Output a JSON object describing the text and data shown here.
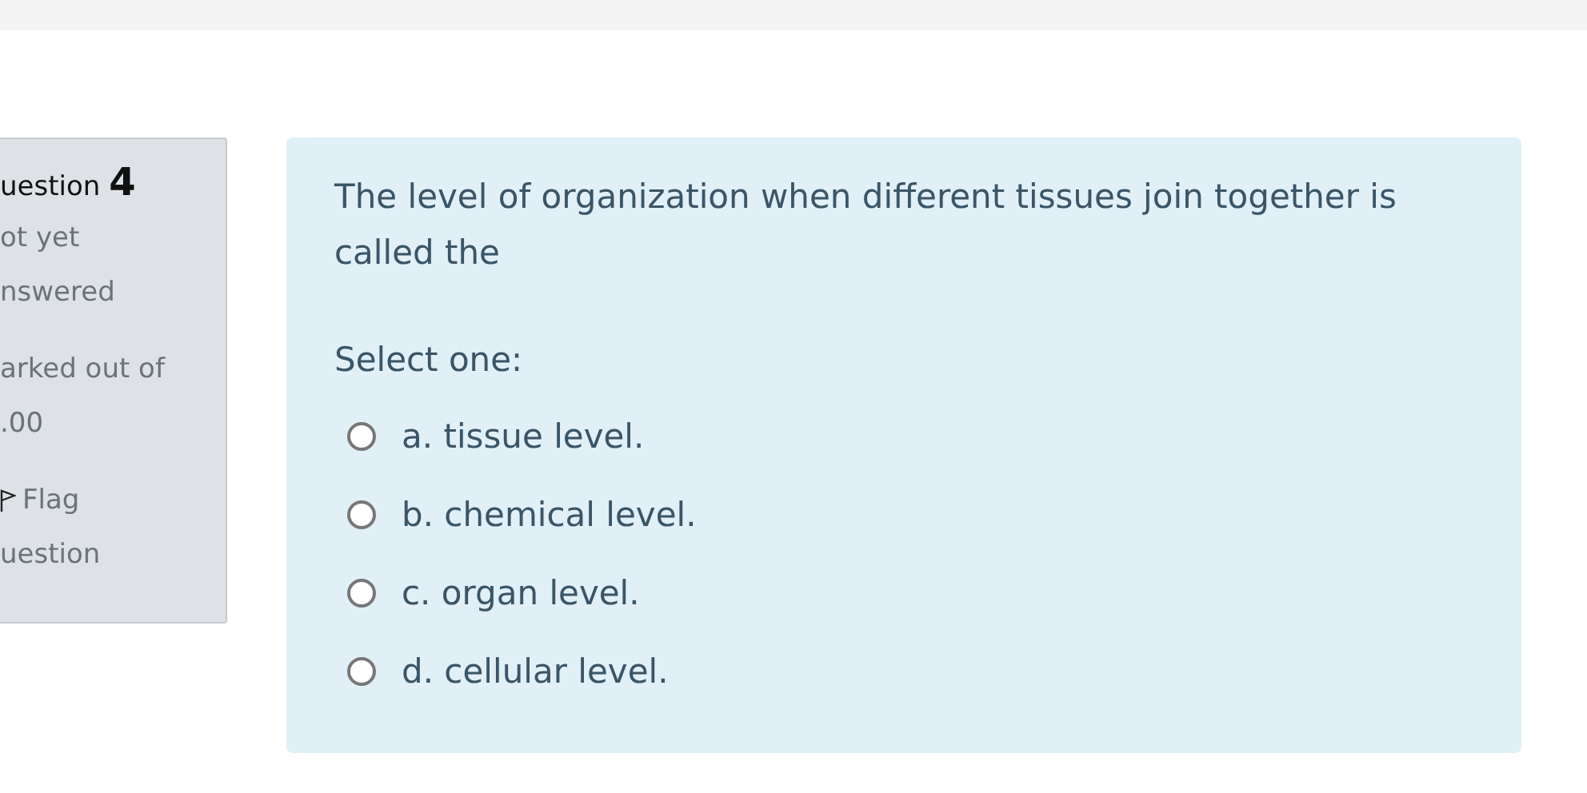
{
  "info": {
    "heading": "uestion",
    "number": "4",
    "state": [
      "ot yet",
      "nswered"
    ],
    "marks": [
      "arked out of",
      ".00"
    ],
    "flag": [
      "Flag",
      "uestion"
    ]
  },
  "question": {
    "text": "The level of organization when different tissues join together is called the",
    "prompt": "Select one:",
    "options": [
      {
        "label": "a. tissue level.",
        "selected": false
      },
      {
        "label": "b. chemical level.",
        "selected": false
      },
      {
        "label": "c. organ level.",
        "selected": false
      },
      {
        "label": "d. cellular level.",
        "selected": false
      }
    ]
  }
}
